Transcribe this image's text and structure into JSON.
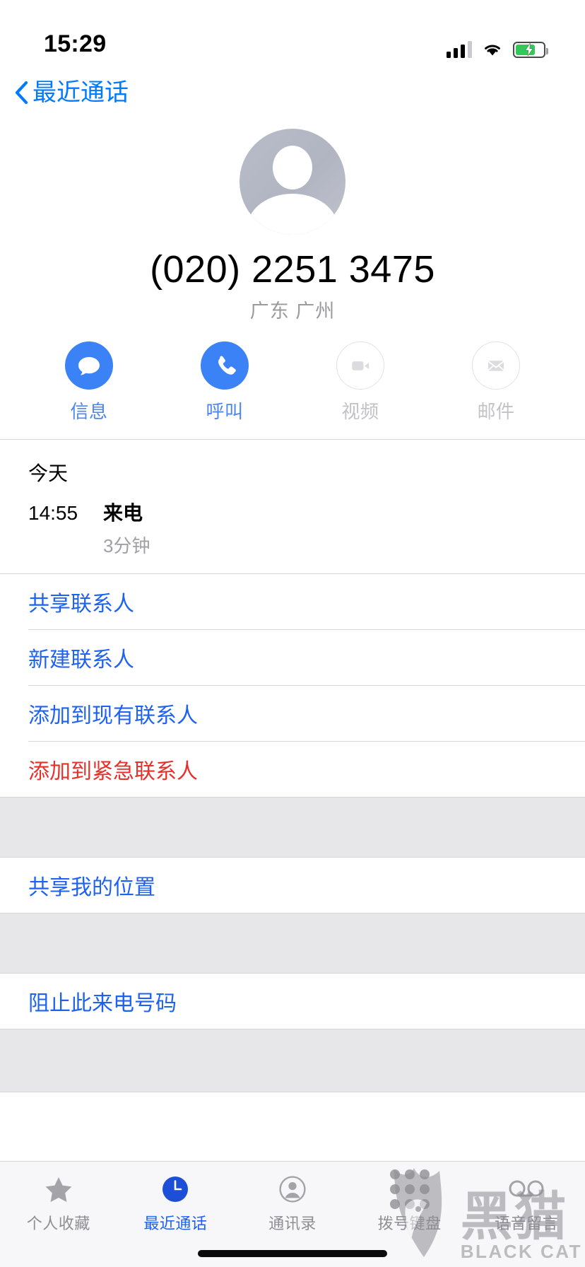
{
  "status_bar": {
    "time": "15:29",
    "cellular_icon": "cellular-bars-icon",
    "wifi_icon": "wifi-icon",
    "battery_icon": "battery-charging-icon",
    "battery_charging": true
  },
  "nav": {
    "back_icon": "chevron-left-icon",
    "back_label": "最近通话"
  },
  "contact": {
    "avatar_icon": "person-placeholder-avatar",
    "phone_number": "(020) 2251 3475",
    "locality": "广东 广州"
  },
  "actions": [
    {
      "label": "信息",
      "icon": "message-bubble-icon",
      "enabled": true,
      "name": "action-message"
    },
    {
      "label": "呼叫",
      "icon": "phone-handset-icon",
      "enabled": true,
      "name": "action-call"
    },
    {
      "label": "视频",
      "icon": "video-camera-icon",
      "enabled": false,
      "name": "action-video"
    },
    {
      "label": "邮件",
      "icon": "envelope-icon",
      "enabled": false,
      "name": "action-mail"
    }
  ],
  "call_log": {
    "day_label": "今天",
    "entries": [
      {
        "time": "14:55",
        "type": "来电",
        "duration": "3分钟"
      }
    ]
  },
  "list_sections": [
    {
      "items": [
        {
          "label": "共享联系人",
          "style": "blue",
          "name": "share-contact-row"
        },
        {
          "label": "新建联系人",
          "style": "blue",
          "name": "create-new-contact-row"
        },
        {
          "label": "添加到现有联系人",
          "style": "blue",
          "name": "add-to-existing-contact-row"
        },
        {
          "label": "添加到紧急联系人",
          "style": "red",
          "name": "add-to-emergency-contacts-row"
        }
      ]
    },
    {
      "items": [
        {
          "label": "共享我的位置",
          "style": "blue",
          "name": "share-my-location-row"
        }
      ]
    },
    {
      "items": [
        {
          "label": "阻止此来电号码",
          "style": "blue",
          "name": "block-this-caller-row"
        }
      ]
    }
  ],
  "tabs": [
    {
      "label": "个人收藏",
      "icon": "star-icon",
      "active": false,
      "name": "tab-favorites"
    },
    {
      "label": "最近通话",
      "icon": "clock-icon",
      "active": true,
      "name": "tab-recents"
    },
    {
      "label": "通讯录",
      "icon": "person-circle-icon",
      "active": false,
      "name": "tab-contacts"
    },
    {
      "label": "拨号键盘",
      "icon": "keypad-icon",
      "active": false,
      "name": "tab-keypad"
    },
    {
      "label": "语音留言",
      "icon": "voicemail-icon",
      "active": false,
      "name": "tab-voicemail"
    }
  ],
  "watermark": {
    "cn": "黑猫",
    "en": "BLACK CAT",
    "logo_icon": "black-cat-shield-logo"
  },
  "colors": {
    "accent_blue": "#007aff",
    "link_blue": "#1d62f0",
    "action_blue": "#3b82f6",
    "destructive_red": "#e8302a",
    "disabled_gray": "#c2c2c7",
    "separator": "#d6d6da",
    "group_bg": "#e7e7ea",
    "tabbar_bg": "#f7f7fa",
    "battery_green": "#34c759"
  }
}
